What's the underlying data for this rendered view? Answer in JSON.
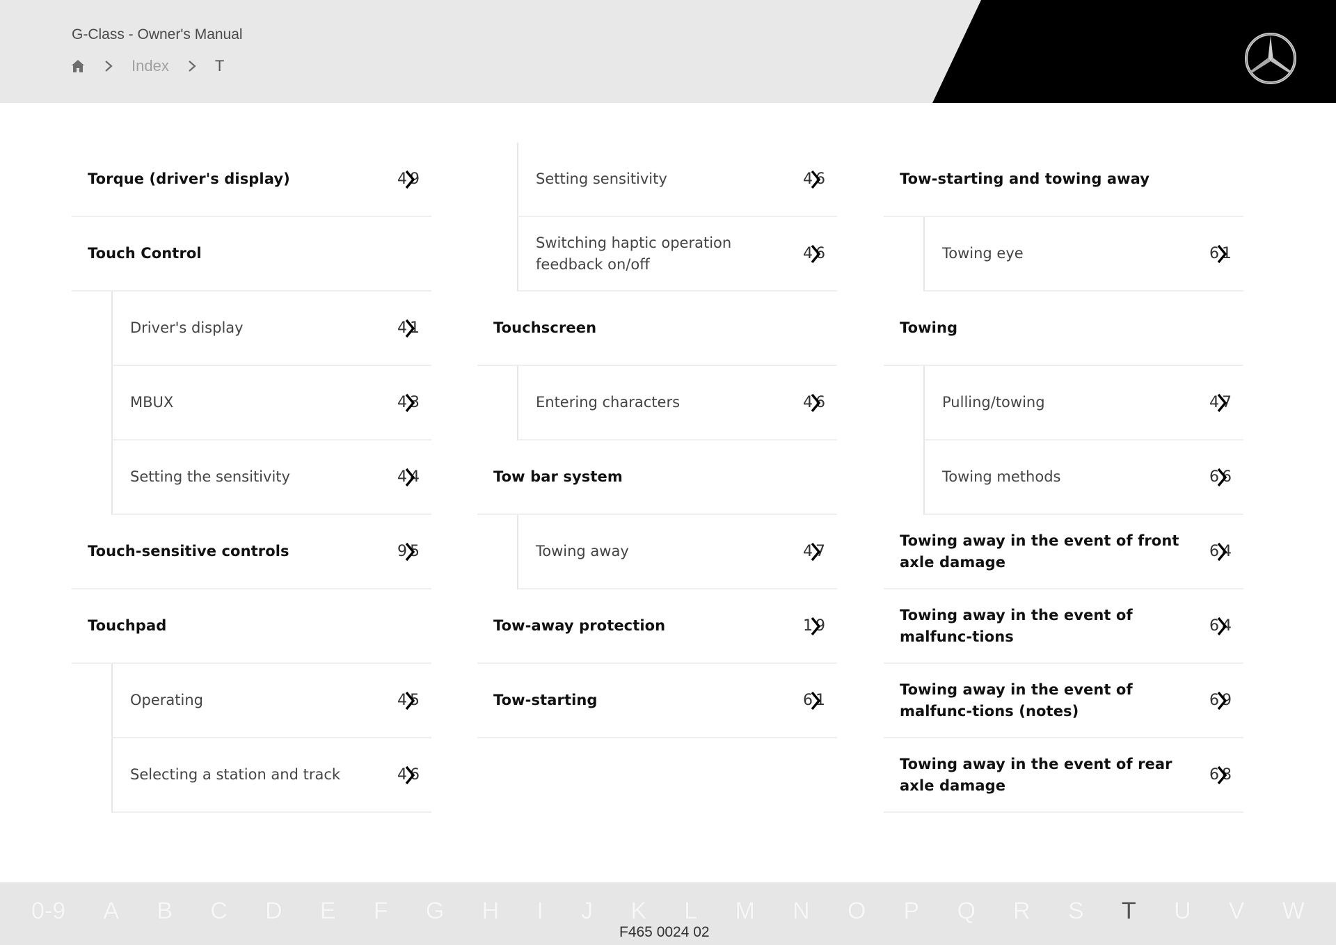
{
  "header": {
    "title": "G-Class - Owner's Manual",
    "breadcrumb": {
      "home_icon": "home-icon",
      "items": [
        "Index",
        "T"
      ]
    },
    "logo": "mercedes-benz-star-logo"
  },
  "columns": [
    {
      "entries": [
        {
          "type": "main",
          "label": "Torque (driver's display)",
          "page_visible": [
            "4",
            "9"
          ]
        },
        {
          "type": "main",
          "label": "Touch Control",
          "page_visible": null
        },
        {
          "type": "sub",
          "label": "Driver's display",
          "page_visible": [
            "4",
            "1"
          ]
        },
        {
          "type": "sub",
          "label": "MBUX",
          "page_visible": [
            "4",
            "3"
          ]
        },
        {
          "type": "sub",
          "label": "Setting the sensitivity",
          "page_visible": [
            "4",
            "4"
          ]
        },
        {
          "type": "main",
          "label": "Touch-sensitive controls",
          "page_visible": [
            "9",
            "5"
          ]
        },
        {
          "type": "main",
          "label": "Touchpad",
          "page_visible": null
        },
        {
          "type": "sub",
          "label": "Operating",
          "page_visible": [
            "4",
            "5"
          ]
        },
        {
          "type": "sub",
          "label": "Selecting a station and track",
          "page_visible": [
            "4",
            "6"
          ]
        }
      ]
    },
    {
      "entries": [
        {
          "type": "sub",
          "label": "Setting sensitivity",
          "page_visible": [
            "4",
            "6"
          ]
        },
        {
          "type": "sub",
          "label": "Switching haptic operation feedback on/off",
          "page_visible": [
            "4",
            "6"
          ]
        },
        {
          "type": "main",
          "label": "Touchscreen",
          "page_visible": null
        },
        {
          "type": "sub",
          "label": "Entering characters",
          "page_visible": [
            "4",
            "6"
          ]
        },
        {
          "type": "main",
          "label": "Tow bar system",
          "page_visible": null
        },
        {
          "type": "sub",
          "label": "Towing away",
          "page_visible": [
            "4",
            "7"
          ]
        },
        {
          "type": "main",
          "label": "Tow-away protection",
          "page_visible": [
            "1",
            "9"
          ]
        },
        {
          "type": "main",
          "label": "Tow-starting",
          "page_visible": [
            "6",
            "1"
          ]
        }
      ]
    },
    {
      "entries": [
        {
          "type": "main",
          "label": "Tow-starting and towing away",
          "page_visible": null
        },
        {
          "type": "sub",
          "label": "Towing eye",
          "page_visible": [
            "6",
            "1"
          ]
        },
        {
          "type": "main",
          "label": "Towing",
          "page_visible": null
        },
        {
          "type": "sub",
          "label": "Pulling/towing",
          "page_visible": [
            "4",
            "7"
          ]
        },
        {
          "type": "sub",
          "label": "Towing methods",
          "page_visible": [
            "6",
            "6"
          ]
        },
        {
          "type": "main",
          "label": "Towing away in the event of front axle damage",
          "page_visible": [
            "6",
            "4"
          ]
        },
        {
          "type": "main",
          "label": "Towing away in the event of malfunc-tions",
          "page_visible": [
            "6",
            "4"
          ]
        },
        {
          "type": "main",
          "label": "Towing away in the event of malfunc-tions (notes)",
          "page_visible": [
            "6",
            "9"
          ]
        },
        {
          "type": "main",
          "label": "Towing away in the event of rear axle damage",
          "page_visible": [
            "6",
            "8"
          ]
        }
      ]
    }
  ],
  "footer": {
    "alphabet": [
      "0-9",
      "A",
      "B",
      "C",
      "D",
      "E",
      "F",
      "G",
      "H",
      "I",
      "J",
      "K",
      "L",
      "M",
      "N",
      "O",
      "P",
      "Q",
      "R",
      "S",
      "T",
      "U",
      "V",
      "W"
    ],
    "active_letter": "T",
    "doc_code": "F465 0024 02"
  },
  "colors": {
    "header_bg": "#e8e8e8",
    "brand_black": "#000000",
    "footer_bg": "#e6e6e6"
  }
}
